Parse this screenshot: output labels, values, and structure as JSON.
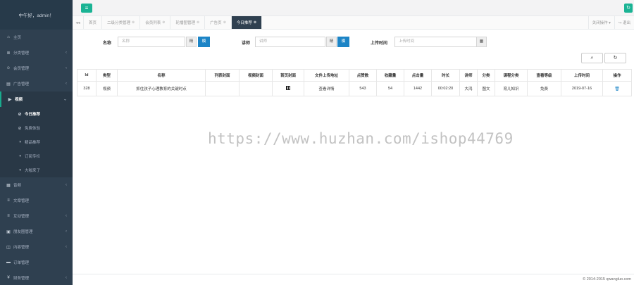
{
  "sidebar": {
    "header": "中午好，admin！",
    "items": [
      {
        "icon": "home-icon",
        "glyph": "⌂",
        "label": "主页",
        "arrow": ""
      },
      {
        "icon": "list-icon",
        "glyph": "≣",
        "label": "分类管理",
        "arrow": "‹"
      },
      {
        "icon": "user-icon",
        "glyph": "☺",
        "label": "会员管理",
        "arrow": "‹"
      },
      {
        "icon": "ad-icon",
        "glyph": "▤",
        "label": "广告管理",
        "arrow": "‹"
      },
      {
        "icon": "video-icon",
        "glyph": "▶",
        "label": "视频",
        "arrow": "⌄"
      }
    ],
    "video_subitems": [
      {
        "icon": "circle-slash-icon",
        "glyph": "⊘",
        "label": "今日推荐"
      },
      {
        "icon": "circle-slash-icon",
        "glyph": "⊘",
        "label": "免费体验"
      },
      {
        "icon": "half-circle-icon",
        "glyph": "◑",
        "label": "精品推荐"
      },
      {
        "icon": "half-circle-icon",
        "glyph": "◑",
        "label": "订阅专栏"
      },
      {
        "icon": "half-circle-icon",
        "glyph": "◑",
        "label": "大咖来了"
      }
    ],
    "items_after": [
      {
        "icon": "audio-icon",
        "glyph": "▦",
        "label": "音频",
        "arrow": "‹"
      },
      {
        "icon": "article-icon",
        "glyph": "≡",
        "label": "文章管理",
        "arrow": ""
      },
      {
        "icon": "interaction-icon",
        "glyph": "≡",
        "label": "互动管理",
        "arrow": "‹"
      },
      {
        "icon": "friends-icon",
        "glyph": "▣",
        "label": "朋友圈管理",
        "arrow": "‹"
      },
      {
        "icon": "content-icon",
        "glyph": "◫",
        "label": "内容管理",
        "arrow": "‹"
      },
      {
        "icon": "order-icon",
        "glyph": "▬",
        "label": "订单管理",
        "arrow": ""
      },
      {
        "icon": "finance-icon",
        "glyph": "¥",
        "label": "财务管理",
        "arrow": "‹"
      }
    ]
  },
  "topbar": {
    "menu_glyph": "≡",
    "refresh_glyph": "↻"
  },
  "tabs": {
    "nav_back": "◂◂",
    "items": [
      {
        "label": "首页",
        "close": ""
      },
      {
        "label": "二级分类管理",
        "close": "⊗"
      },
      {
        "label": "会员列表",
        "close": "⊗"
      },
      {
        "label": "轮播图管理",
        "close": "⊗"
      },
      {
        "label": "广告页",
        "close": "⊗"
      },
      {
        "label": "今日推荐",
        "close": "⊗"
      }
    ],
    "close_ops": "关闭操作 ▾",
    "logout": "↪ 退出"
  },
  "search": {
    "name_label": "名称",
    "name_placeholder": "名称",
    "name_addon": "精",
    "name_btn": "模",
    "lecturer_label": "讲师",
    "lecturer_placeholder": "讲师",
    "lecturer_addon": "精",
    "lecturer_btn": "模",
    "upload_label": "上传时间",
    "upload_placeholder": "上传时间",
    "calendar_glyph": "▦"
  },
  "toolbar": {
    "search_glyph": "⌕",
    "refresh_glyph": "↻"
  },
  "table": {
    "columns": [
      "Id",
      "类型",
      "名称",
      "列表封面",
      "视频封面",
      "首页封面",
      "文件上传地址",
      "点赞数",
      "收藏量",
      "点击量",
      "时长",
      "讲师",
      "分类",
      "课程分类",
      "查看等级",
      "上传时间",
      "操作"
    ],
    "rows": [
      {
        "id": "328",
        "type": "视频",
        "name": "抓住孩子心理教育的关键时点",
        "list_cover": "",
        "video_cover": "",
        "home_cover": "",
        "file_url": "查看详情",
        "likes": "543",
        "favorites": "54",
        "clicks": "1442",
        "duration": "00:02:20",
        "lecturer": "大鸿",
        "category": "图文",
        "course_category": "育儿知识",
        "view_level": "免费",
        "upload_time": "2019-07-16",
        "action_glyph": "🗑"
      }
    ]
  },
  "watermark": "https://www.huzhan.com/ishop44769",
  "footer": {
    "copyright": "© 2014-2015 qwangluo.com"
  },
  "colors": {
    "sidebar_bg": "#2f4050",
    "accent": "#1ab394",
    "primary_btn": "#1c84c6"
  }
}
